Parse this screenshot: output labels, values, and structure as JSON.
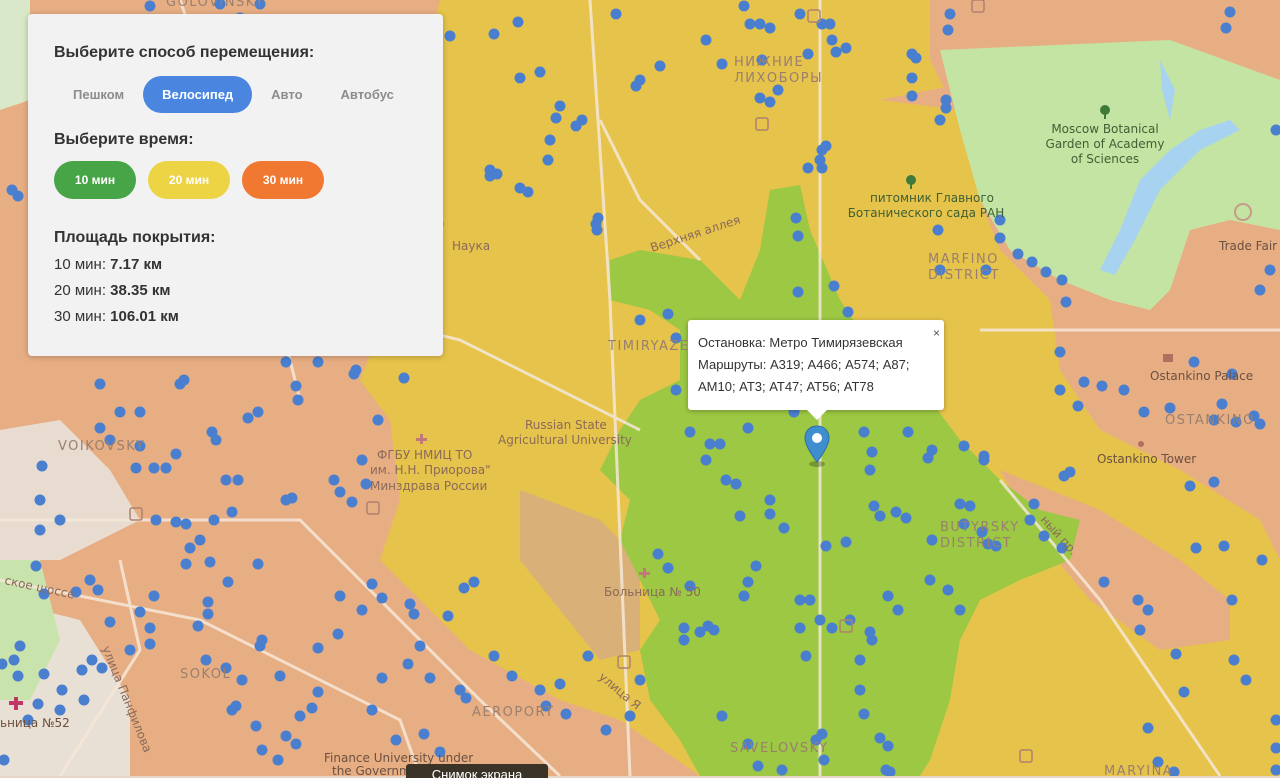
{
  "controls": {
    "mode_title": "Выберите способ перемещения:",
    "modes": [
      "Пешком",
      "Велосипед",
      "Авто",
      "Автобус"
    ],
    "active_mode": "Велосипед",
    "time_title": "Выберите время:",
    "times": [
      {
        "label": "10 мин",
        "color": "#47a447"
      },
      {
        "label": "20 мин",
        "color": "#ecd444"
      },
      {
        "label": "30 мин",
        "color": "#f07830"
      }
    ],
    "area_title": "Площадь покрытия:",
    "areas": [
      {
        "prefix": "10 мин: ",
        "value": "7.17 км"
      },
      {
        "prefix": "20 мин: ",
        "value": "38.35 км"
      },
      {
        "prefix": "30 мин: ",
        "value": "106.01 км"
      }
    ]
  },
  "popup": {
    "line1": "Остановка: Метро Тимирязевская",
    "line2": "Маршруты: А319; А466; А574; А87;",
    "line3": "АМ10; АТ3; АТ47; АТ56; АТ78",
    "close": "×"
  },
  "map": {
    "zone_colors": {
      "ten": "#9bc840",
      "twenty": "#e6c34a",
      "thirty": "#e8ad82",
      "park": "#c5e3a3",
      "base": "#e9d9c6"
    },
    "stop_color": "#4a7fd0",
    "labels": {
      "golovinsky": "GOLOVINSKY",
      "nizhnie1": "НИЖНИЕ",
      "nizhnie2": "ЛИХОБОРЫ",
      "botanical1": "Moscow Botanical",
      "botanical2": "Garden of Academy",
      "botanical3": "of Sciences",
      "pitomnik1": "питомник Главного",
      "pitomnik2": "Ботанического сада РАН",
      "trade_fair": "Trade Fair",
      "marfino1": "MARFINO",
      "marfino2": "DISTRICT",
      "nauka": "Наука",
      "verkhnyaya": "Верхняя аллея",
      "timiryazev": "TIMIRYAZE",
      "ostankino_palace": "Ostankino Palace",
      "ostankino": "OSTANKINO",
      "ostankino_tower": "Ostankino Tower",
      "rsau1": "Russian State",
      "rsau2": "Agricultural University",
      "voikovsky": "VOIKOVSKY",
      "fgbu1": "ФГБУ НМИЦ ТО",
      "fgbu2": "им. Н.Н. Приорова\"",
      "fgbu3": "Минздрава России",
      "butyrsky": "BUTYRSKY",
      "district": "DISTRICT",
      "bolnitsa": "Больница № 50",
      "shosse": "ское шоссе",
      "panfilova": "улица Панфилова",
      "sokol": "SOKOL",
      "aeroport": "AEROPORT",
      "bolnitsa52": "ьница №52",
      "finance1": "Finance University under",
      "finance2": "the Governm",
      "savelovsky": "SAVELOVSKY",
      "maryina": "MARYINA",
      "prospekt": "ный пр.",
      "ulitsa": "улица Я"
    }
  },
  "overlay": {
    "screenshot_label": "Снимок экрана"
  }
}
